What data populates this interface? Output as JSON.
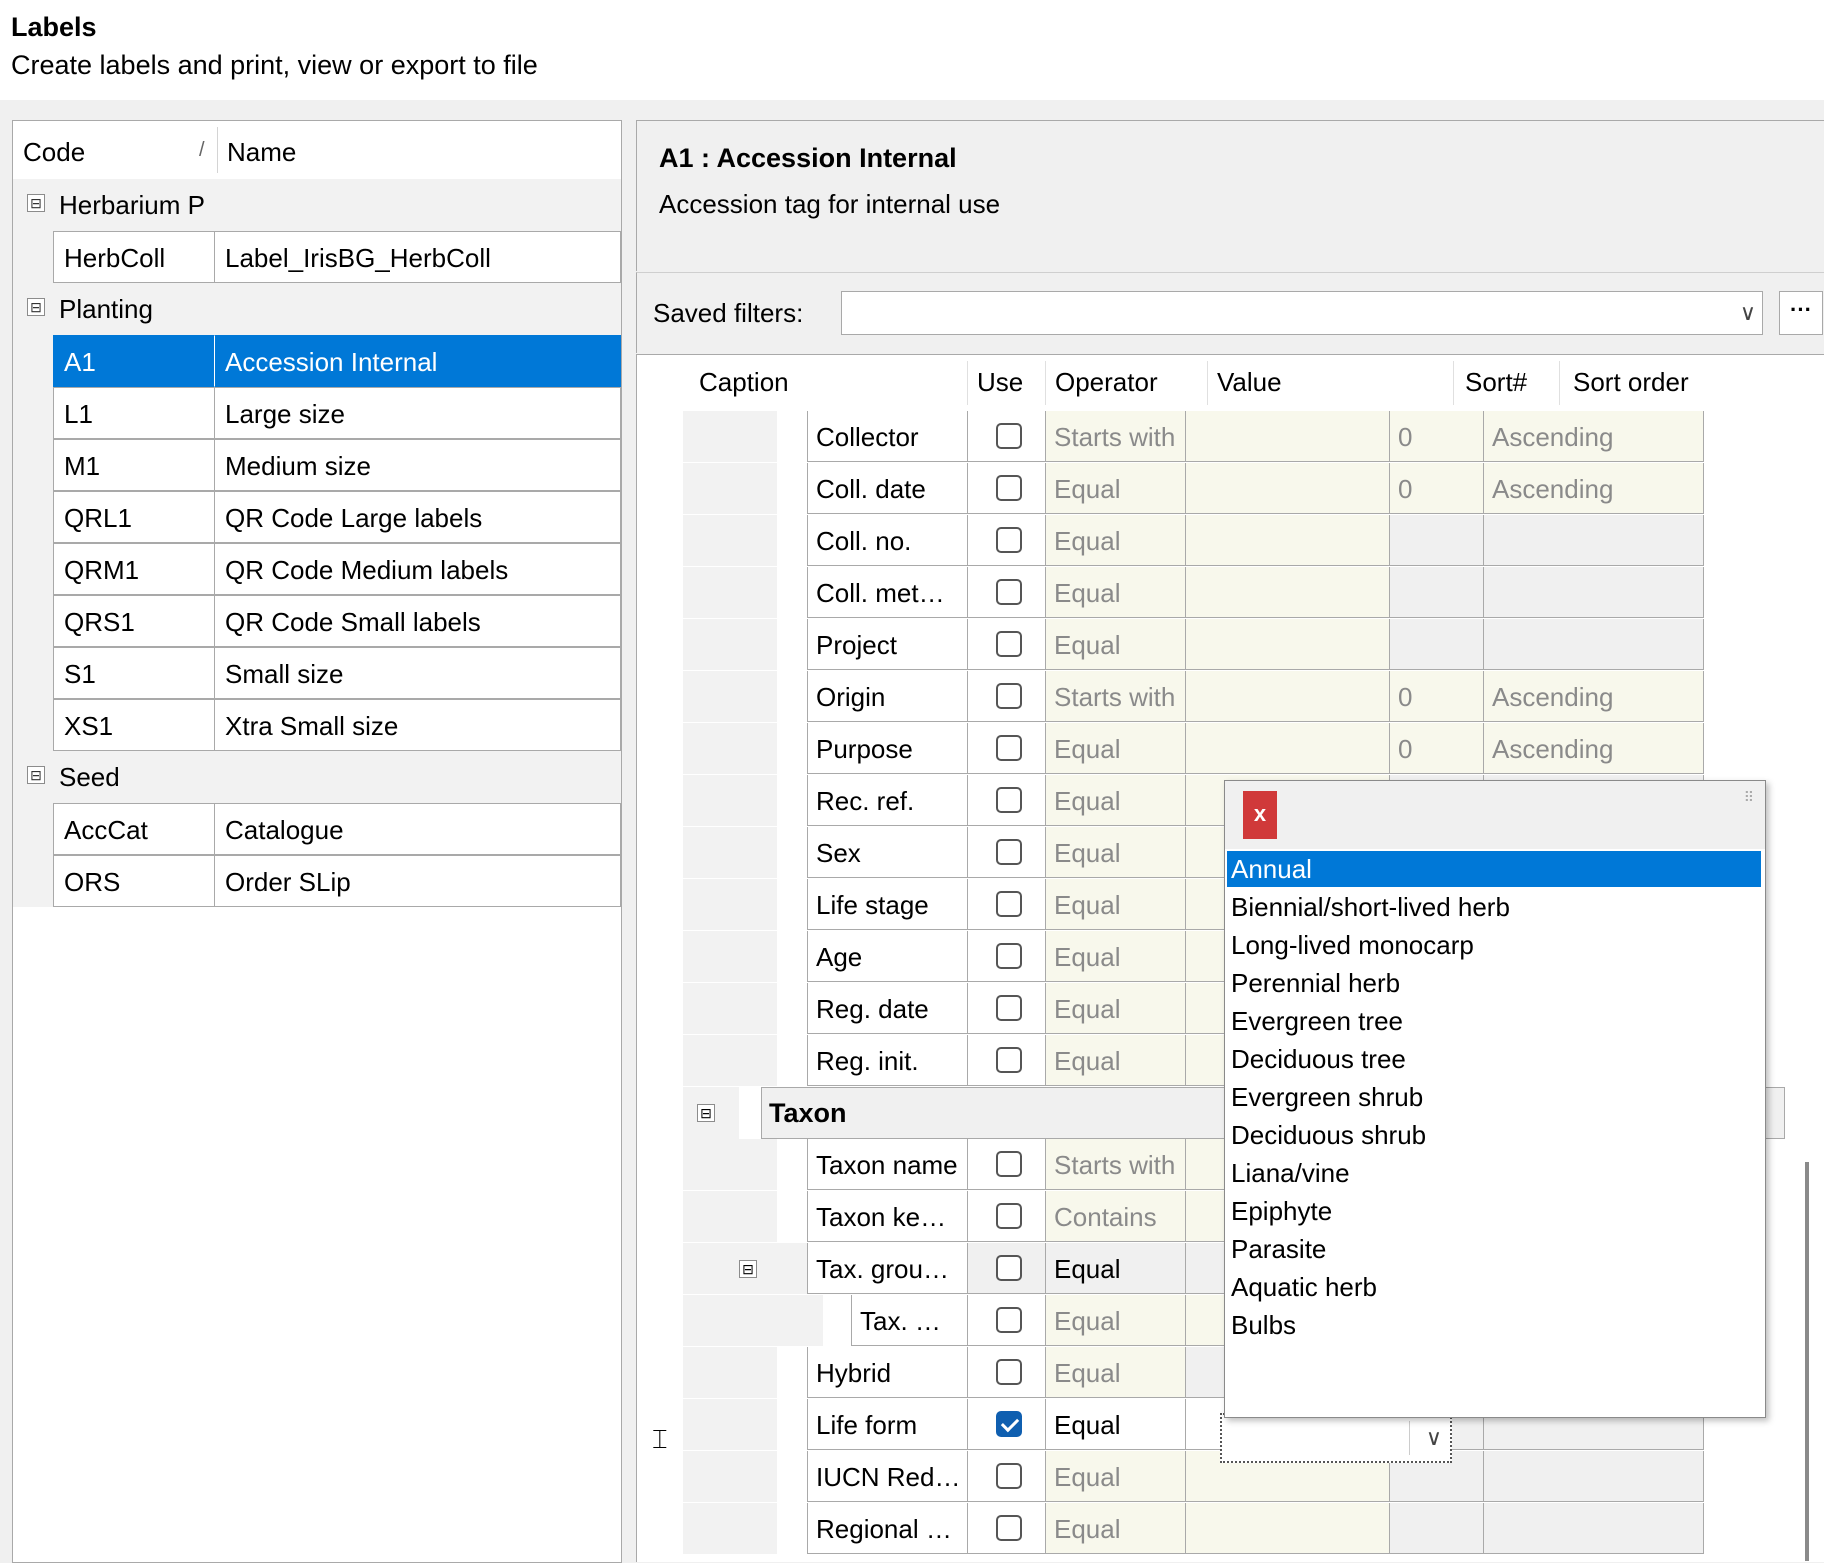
{
  "header": {
    "title": "Labels",
    "subtitle": "Create labels and print, view or export to file"
  },
  "labels_list": {
    "columns": {
      "code": "Code",
      "name": "Name",
      "sort_indicator": "/"
    },
    "groups": [
      {
        "name": "Herbarium P",
        "items": [
          {
            "code": "HerbColl",
            "name": "Label_IrisBG_HerbColl"
          }
        ]
      },
      {
        "name": "Planting",
        "items": [
          {
            "code": "A1",
            "name": "Accession Internal",
            "selected": true
          },
          {
            "code": "L1",
            "name": "Large size"
          },
          {
            "code": "M1",
            "name": "Medium size"
          },
          {
            "code": "QRL1",
            "name": "QR Code Large labels"
          },
          {
            "code": "QRM1",
            "name": "QR Code Medium labels"
          },
          {
            "code": "QRS1",
            "name": "QR Code Small labels"
          },
          {
            "code": "S1",
            "name": "Small size"
          },
          {
            "code": "XS1",
            "name": "Xtra Small size"
          }
        ]
      },
      {
        "name": "Seed",
        "items": [
          {
            "code": "AccCat",
            "name": "Catalogue"
          },
          {
            "code": "ORS",
            "name": "Order SLip"
          }
        ]
      }
    ],
    "toggle_glyph": "⊟"
  },
  "detail": {
    "title": "A1 : Accession Internal",
    "description": "Accession tag for internal use"
  },
  "filters": {
    "label": "Saved filters:",
    "value": "",
    "more_label": "···"
  },
  "grid": {
    "columns": {
      "caption": "Caption",
      "use": "Use",
      "operator": "Operator",
      "value": "Value",
      "sort_num": "Sort#",
      "sort_order": "Sort order"
    },
    "rows_upper": [
      {
        "caption": "Collector",
        "use": false,
        "operator": "Starts with",
        "sort_num": "0",
        "sort_order": "Ascending"
      },
      {
        "caption": "Coll. date",
        "use": false,
        "operator": "Equal",
        "sort_num": "0",
        "sort_order": "Ascending"
      },
      {
        "caption": "Coll. no.",
        "use": false,
        "operator": "Equal",
        "sort_num": "",
        "sort_order": ""
      },
      {
        "caption": "Coll. met…",
        "use": false,
        "operator": "Equal",
        "sort_num": "",
        "sort_order": ""
      },
      {
        "caption": "Project",
        "use": false,
        "operator": "Equal",
        "sort_num": "",
        "sort_order": ""
      },
      {
        "caption": "Origin",
        "use": false,
        "operator": "Starts with",
        "sort_num": "0",
        "sort_order": "Ascending"
      },
      {
        "caption": "Purpose",
        "use": false,
        "operator": "Equal",
        "sort_num": "0",
        "sort_order": "Ascending"
      },
      {
        "caption": "Rec. ref.",
        "use": false,
        "operator": "Equal"
      },
      {
        "caption": "Sex",
        "use": false,
        "operator": "Equal"
      },
      {
        "caption": "Life stage",
        "use": false,
        "operator": "Equal"
      },
      {
        "caption": "Age",
        "use": false,
        "operator": "Equal"
      },
      {
        "caption": "Reg. date",
        "use": false,
        "operator": "Equal"
      },
      {
        "caption": "Reg. init.",
        "use": false,
        "operator": "Equal"
      }
    ],
    "taxon_group": "Taxon",
    "rows_lower": [
      {
        "caption": "Taxon name",
        "use": false,
        "operator": "Starts with"
      },
      {
        "caption": "Taxon ke…",
        "use": false,
        "operator": "Contains"
      },
      {
        "caption": "Tax. grou…",
        "use": false,
        "operator": "Equal"
      },
      {
        "caption": "Tax. …",
        "use": false,
        "operator": "Equal"
      },
      {
        "caption": "Hybrid",
        "use": false,
        "operator": "Equal"
      },
      {
        "caption": "Life form",
        "use": true,
        "operator": "Equal"
      },
      {
        "caption": "IUCN Red…",
        "use": false,
        "operator": "Equal"
      },
      {
        "caption": "Regional …",
        "use": false,
        "operator": "Equal"
      }
    ]
  },
  "life_form_dropdown": {
    "close_label": "x",
    "options": [
      "Annual",
      "Biennial/short-lived herb",
      "Long-lived monocarp",
      "Perennial herb",
      "Evergreen tree",
      "Deciduous tree",
      "Evergreen shrub",
      "Deciduous shrub",
      "Liana/vine",
      "Epiphyte",
      "Parasite",
      "Aquatic herb",
      "Bulbs"
    ],
    "selected": "Annual"
  },
  "icons": {
    "dropdown": "chevron-down-icon",
    "close": "close-icon",
    "expand": "collapse-icon",
    "cursor": "text-cursor-icon"
  }
}
